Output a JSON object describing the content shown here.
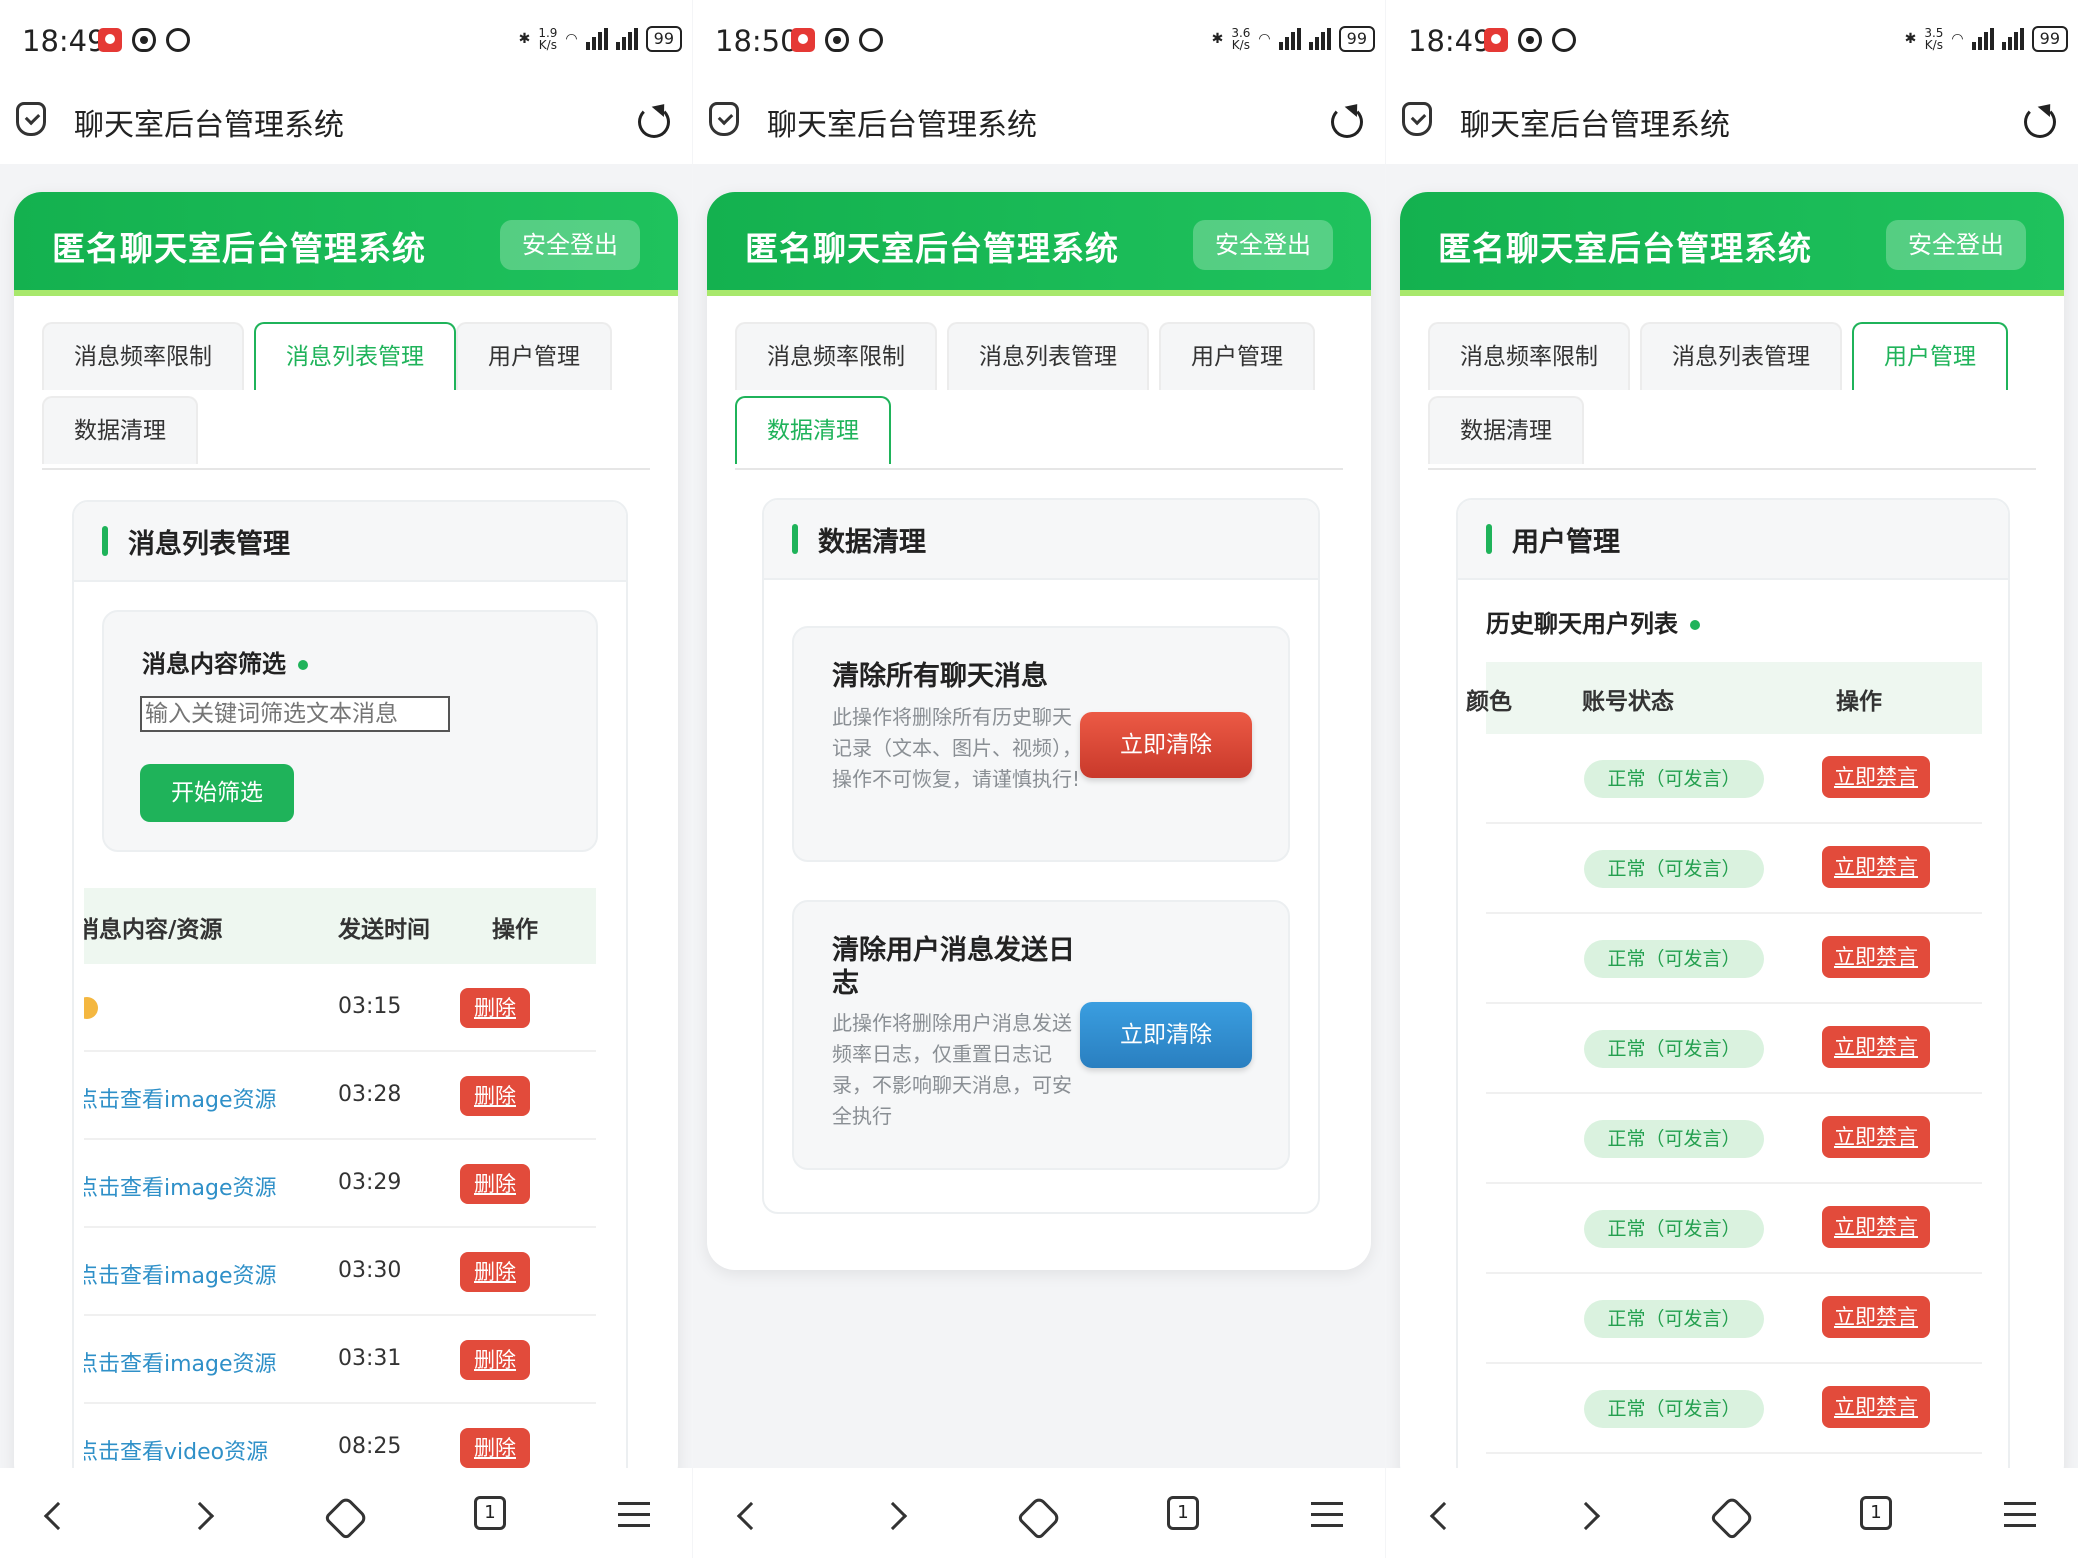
{
  "screens": [
    {
      "status": {
        "time": "18:49",
        "speed_top": "1.9",
        "speed_unit": "K/s",
        "battery": "99"
      },
      "browser_title": "聊天室后台管理系统"
    },
    {
      "status": {
        "time": "18:50",
        "speed_top": "3.6",
        "speed_unit": "K/s",
        "battery": "99"
      },
      "browser_title": "聊天室后台管理系统"
    },
    {
      "status": {
        "time": "18:49",
        "speed_top": "3.5",
        "speed_unit": "K/s",
        "battery": "99"
      },
      "browser_title": "聊天室后台管理系统"
    }
  ],
  "app": {
    "title": "匿名聊天室后台管理系统",
    "logout": "安全登出",
    "tabs": [
      "消息频率限制",
      "消息列表管理",
      "用户管理",
      "数据清理"
    ],
    "accent_color": "#1fb35a"
  },
  "messages_panel": {
    "title": "消息列表管理",
    "filter_title": "消息内容筛选",
    "filter_placeholder": "输入关键词筛选文本消息",
    "filter_button": "开始筛选",
    "columns": [
      "消息内容/资源",
      "发送时间",
      "操作"
    ],
    "rows": [
      {
        "content": "",
        "time": "03:15",
        "action": "删除"
      },
      {
        "content": "点击查看image资源",
        "time": "03:28",
        "action": "删除"
      },
      {
        "content": "点击查看image资源",
        "time": "03:29",
        "action": "删除"
      },
      {
        "content": "点击查看image资源",
        "time": "03:30",
        "action": "删除"
      },
      {
        "content": "点击查看image资源",
        "time": "03:31",
        "action": "删除"
      },
      {
        "content": "点击查看video资源",
        "time": "08:25",
        "action": "删除"
      }
    ]
  },
  "clean_panel": {
    "title": "数据清理",
    "items": [
      {
        "title": "清除所有聊天消息",
        "desc": "此操作将删除所有历史聊天记录（文本、图片、视频），操作不可恢复，请谨慎执行!",
        "button": "立即清除",
        "color": "#d8422f"
      },
      {
        "title": "清除用户消息发送日志",
        "desc": "此操作将删除用户消息发送频率日志，仅重置日志记录，不影响聊天消息，可安全执行",
        "button": "立即清除",
        "color": "#2f8ed2"
      }
    ]
  },
  "users_panel": {
    "title": "用户管理",
    "subtitle": "历史聊天用户列表",
    "columns": [
      "颜色",
      "账号状态",
      "操作"
    ],
    "rows": [
      {
        "status": "正常（可发言）",
        "action": "立即禁言"
      },
      {
        "status": "正常（可发言）",
        "action": "立即禁言"
      },
      {
        "status": "正常（可发言）",
        "action": "立即禁言"
      },
      {
        "status": "正常（可发言）",
        "action": "立即禁言"
      },
      {
        "status": "正常（可发言）",
        "action": "立即禁言"
      },
      {
        "status": "正常（可发言）",
        "action": "立即禁言"
      },
      {
        "status": "正常（可发言）",
        "action": "立即禁言"
      },
      {
        "status": "正常（可发言）",
        "action": "立即禁言"
      }
    ]
  }
}
